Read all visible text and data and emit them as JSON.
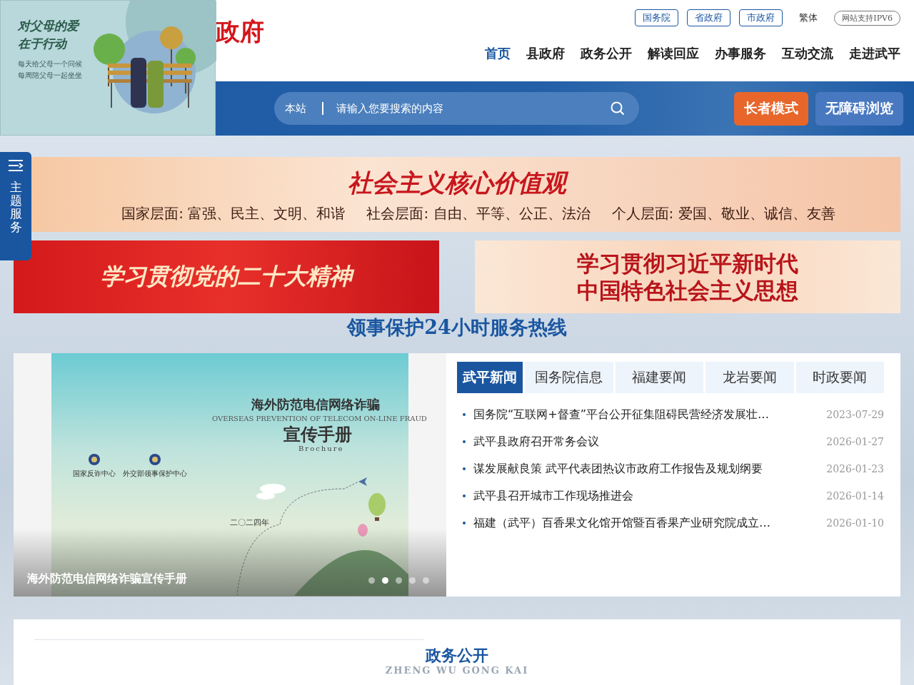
{
  "ad": {
    "title_lines": [
      "对父母的爱",
      "在于行动"
    ],
    "sub_lines": [
      "每天给父母一个问候",
      "每周陪父母一起坐坐"
    ]
  },
  "header": {
    "logo": "政府",
    "top_links": [
      {
        "label": "国务院",
        "kind": "boxed"
      },
      {
        "label": "省政府",
        "kind": "boxed"
      },
      {
        "label": "市政府",
        "kind": "boxed"
      },
      {
        "label": "繁体",
        "kind": "plain"
      },
      {
        "label": "网站支持IPV6",
        "kind": "pill"
      }
    ],
    "nav": [
      {
        "label": "首页",
        "selected": true
      },
      {
        "label": "县政府",
        "selected": false
      },
      {
        "label": "政务公开",
        "selected": false
      },
      {
        "label": "解读回应",
        "selected": false
      },
      {
        "label": "办事服务",
        "selected": false
      },
      {
        "label": "互动交流",
        "selected": false
      },
      {
        "label": "走进武平",
        "selected": false
      }
    ]
  },
  "search": {
    "scope": "本站",
    "placeholder": "请输入您要搜索的内容"
  },
  "mode_buttons": [
    {
      "label": "长者模式",
      "kind": "elder"
    },
    {
      "label": "无障碍浏览",
      "kind": "access"
    }
  ],
  "side_tab": {
    "label": "主题服务"
  },
  "values_banner": {
    "title": "社会主义核心价值观",
    "lines": [
      "国家层面: 富强、民主、文明、和谐",
      "社会层面: 自由、平等、公正、法治",
      "个人层面: 爱国、敬业、诚信、友善"
    ]
  },
  "banners": [
    {
      "kind": "red",
      "lines": [
        "学习贯彻党的二十大精神"
      ]
    },
    {
      "kind": "peach",
      "lines": [
        "学习贯彻习近平新时代",
        "中国特色社会主义思想"
      ]
    }
  ],
  "hotline": "领事保护24小时服务热线",
  "carousel": {
    "cover": {
      "title": "海外防范电信网络诈骗",
      "english": "OVERSEAS PREVENTION OF TELECOM ON-LINE FRAUD",
      "subtitle": "宣传手册",
      "subtitle_en": "Brochure",
      "year": "二〇二四年",
      "orgs": [
        "国家反诈中心",
        "外交部领事保护中心"
      ]
    },
    "caption": "海外防范电信网络诈骗宣传手册",
    "dots": [
      {
        "selected": false
      },
      {
        "selected": true
      },
      {
        "selected": false
      },
      {
        "selected": false
      },
      {
        "selected": false
      }
    ]
  },
  "news": {
    "tabs": [
      {
        "label": "武平新闻",
        "selected": true
      },
      {
        "label": "国务院信息",
        "selected": false
      },
      {
        "label": "福建要闻",
        "selected": false
      },
      {
        "label": "龙岩要闻",
        "selected": false
      },
      {
        "label": "时政要闻",
        "selected": false
      }
    ],
    "items": [
      {
        "title": "国务院“互联网+督查”平台公开征集阻碍民营经济发展壮…",
        "date": "2023-07-29"
      },
      {
        "title": "武平县政府召开常务会议",
        "date": "2026-01-27"
      },
      {
        "title": "谋发展献良策 武平代表团热议市政府工作报告及规划纲要",
        "date": "2026-01-23"
      },
      {
        "title": "武平县召开城市工作现场推进会",
        "date": "2026-01-14"
      },
      {
        "title": "福建（武平）百香果文化馆开馆暨百香果产业研究院成立…",
        "date": "2026-01-10"
      }
    ]
  },
  "section": {
    "title": "政务公开",
    "subtitle": "ZHENG WU GONG KAI"
  }
}
